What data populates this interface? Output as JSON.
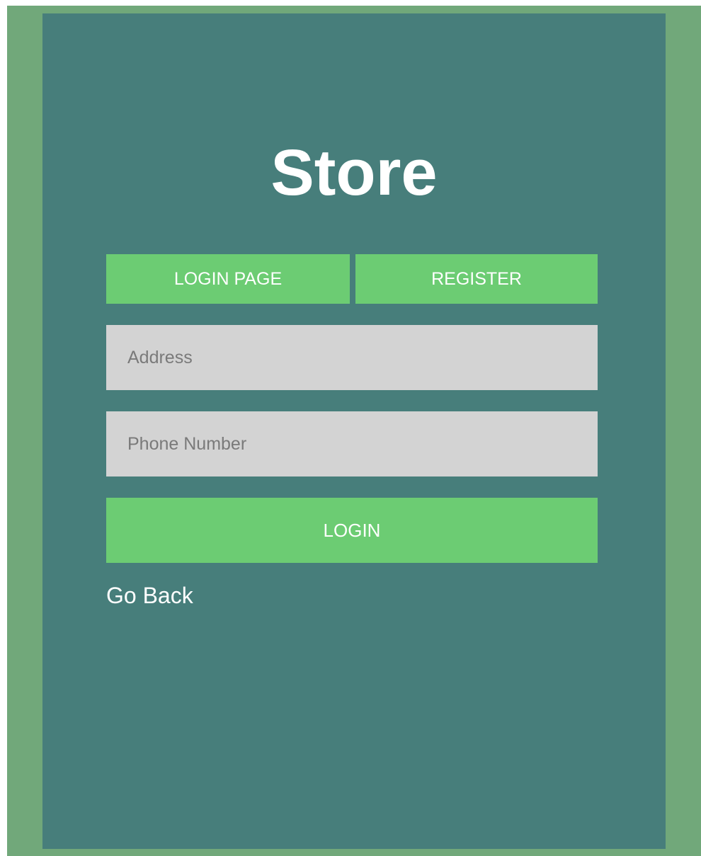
{
  "page": {
    "title": "Store"
  },
  "tabs": {
    "login_label": "LOGIN PAGE",
    "register_label": "REGISTER"
  },
  "form": {
    "address_placeholder": "Address",
    "address_value": "",
    "phone_placeholder": "Phone Number",
    "phone_value": "",
    "submit_label": "LOGIN"
  },
  "links": {
    "go_back_label": "Go Back"
  },
  "colors": {
    "outer_background": "#71a87a",
    "panel_background": "#477e7b",
    "accent_green": "#6ccc73",
    "input_background": "#d3d3d3",
    "text_light": "#ffffff"
  }
}
